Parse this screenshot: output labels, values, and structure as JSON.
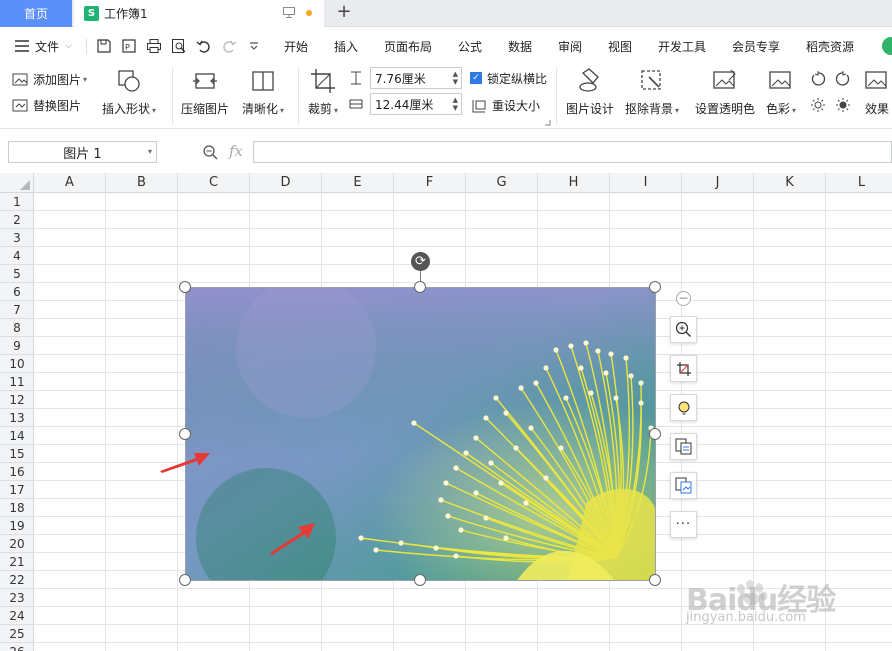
{
  "tabs": {
    "home_label": "首页",
    "doc_label": "工作簿1",
    "doc_icon_letter": "S",
    "add_label": "+"
  },
  "menu": {
    "file_label": "文件",
    "items": [
      "开始",
      "插入",
      "页面布局",
      "公式",
      "数据",
      "审阅",
      "视图",
      "开发工具",
      "会员专享",
      "稻壳资源"
    ]
  },
  "ribbon": {
    "add_picture": "添加图片",
    "replace_picture": "替换图片",
    "insert_shape": "插入形状",
    "compress_picture": "压缩图片",
    "sharpen": "清晰化",
    "crop": "裁剪",
    "height_value": "7.76厘米",
    "width_value": "12.44厘米",
    "lock_ratio": "锁定纵横比",
    "reset_size": "重设大小",
    "picture_design": "图片设计",
    "remove_background": "抠除背景",
    "set_transparent": "设置透明色",
    "color": "色彩",
    "effects": "效果"
  },
  "formula_bar": {
    "name_box": "图片 1",
    "fx": "fx",
    "formula": ""
  },
  "columns": [
    "A",
    "B",
    "C",
    "D",
    "E",
    "F",
    "G",
    "H",
    "I",
    "J",
    "K",
    "L"
  ],
  "rows": [
    "1",
    "2",
    "3",
    "4",
    "5",
    "6",
    "7",
    "8",
    "9",
    "10",
    "11",
    "12",
    "13",
    "14",
    "15",
    "16",
    "17",
    "18",
    "19",
    "20",
    "21",
    "22",
    "23",
    "24",
    "25",
    "26"
  ],
  "side_toolbar": {
    "more_label": "···",
    "collapse_label": "−"
  },
  "watermark": {
    "brand": "Baidu经验",
    "url": "jingyan.baidu.com"
  },
  "colors": {
    "accent": "#5b8ff9",
    "sheet_icon": "#1fb474",
    "annotation_arrow": "#e53935"
  }
}
